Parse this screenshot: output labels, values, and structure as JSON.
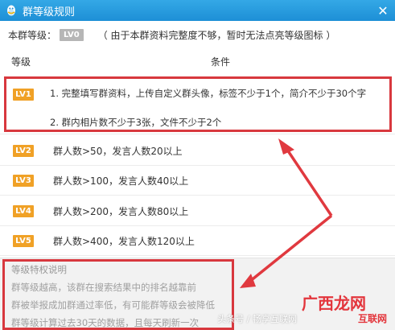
{
  "window": {
    "title": "群等级规则",
    "logo_icon": "qq-penguin-icon",
    "close_icon": "close-icon",
    "accent_color": "#1d8fd6"
  },
  "current_level": {
    "label": "本群等级：",
    "badge": "LV0",
    "note": "（ 由于本群资料完整度不够，暂时无法点亮等级图标 ）"
  },
  "table": {
    "headers": {
      "level": "等级",
      "condition": "条件"
    },
    "badge_color": "#f0a126",
    "rows": [
      {
        "level": "LV1",
        "conditions": [
          "1. 完整填写群资料，上传自定义群头像，标签不少于1个，简介不少于30个字",
          "2. 群内相片数不少于3张，文件不少于2个"
        ]
      },
      {
        "level": "LV2",
        "conditions": [
          "群人数>50，发言人数20以上"
        ]
      },
      {
        "level": "LV3",
        "conditions": [
          "群人数>100，发言人数40以上"
        ]
      },
      {
        "level": "LV4",
        "conditions": [
          "群人数>200，发言人数80以上"
        ]
      },
      {
        "level": "LV5",
        "conditions": [
          "群人数>400，发言人数120以上"
        ]
      }
    ]
  },
  "privilege": {
    "title": "等级特权说明",
    "lines": [
      "群等级越高，该群在搜索结果中的排名越靠前",
      "群被举报成加群通过率低，有可能群等级会被降低",
      "群等级计算过去30天的数据，且每天刷新一次"
    ]
  },
  "annotations": {
    "highlight_color": "#d8383e"
  },
  "watermark": {
    "left": "头条号 / 畅享互联网",
    "big": "广西龙网",
    "small": "互联网"
  }
}
